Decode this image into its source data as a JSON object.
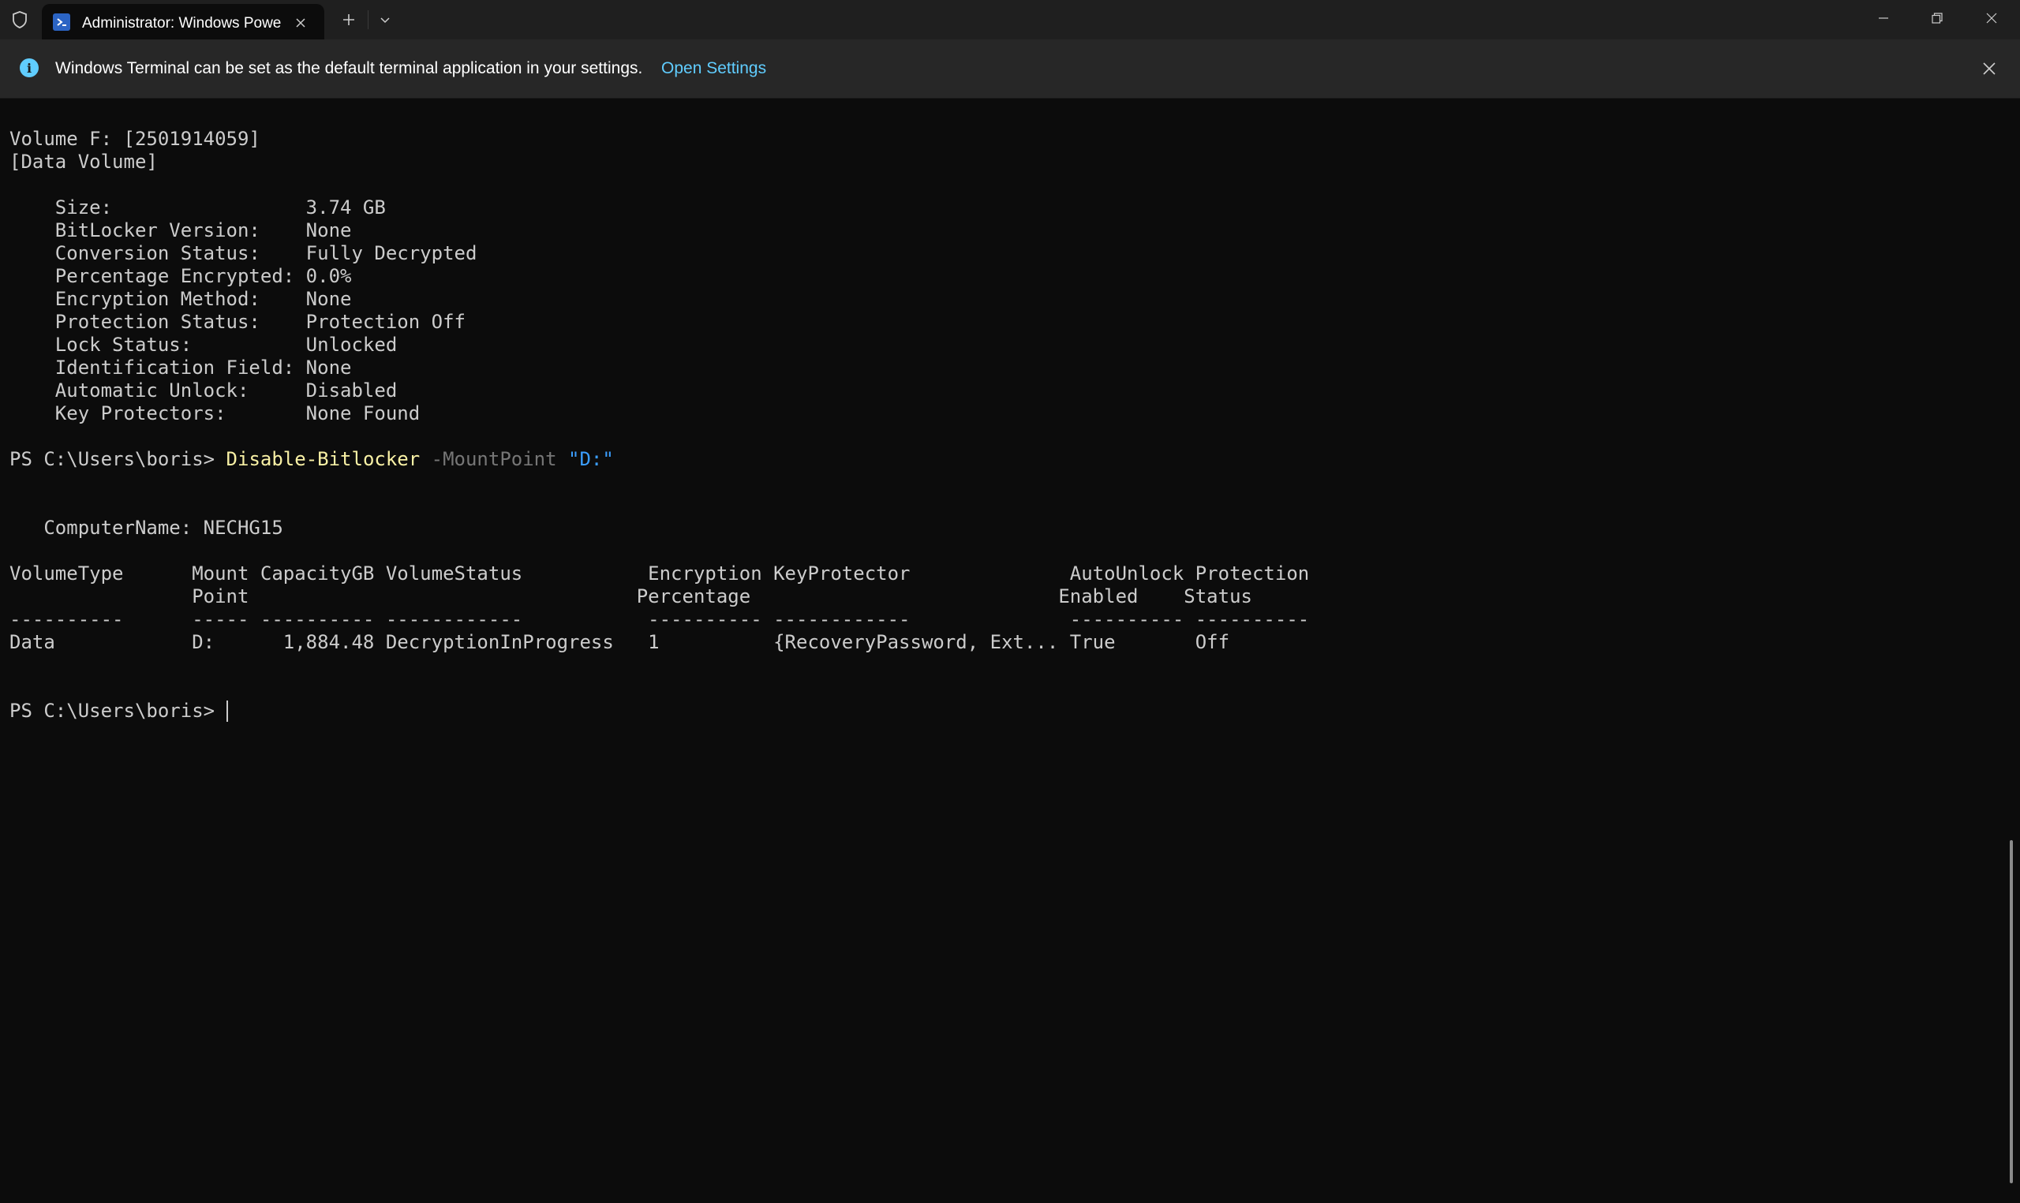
{
  "titlebar": {
    "tab_title": "Administrator: Windows PowerShell",
    "icons": {
      "shield": "shield-icon",
      "tab": "powershell-icon",
      "close": "close-icon",
      "new_tab": "plus-icon",
      "dropdown": "chevron-down-icon",
      "minimize": "minimize-icon",
      "restore": "restore-icon"
    }
  },
  "infobar": {
    "message": "Windows Terminal can be set as the default terminal application in your settings.",
    "link": "Open Settings",
    "icon": "info-icon"
  },
  "terminal": {
    "lines": [
      "Volume F: [2501914059]",
      "[Data Volume]",
      "",
      "    Size:                 3.74 GB",
      "    BitLocker Version:    None",
      "    Conversion Status:    Fully Decrypted",
      "    Percentage Encrypted: 0.0%",
      "    Encryption Method:    None",
      "    Protection Status:    Protection Off",
      "    Lock Status:          Unlocked",
      "    Identification Field: None",
      "    Automatic Unlock:     Disabled",
      "    Key Protectors:       None Found",
      ""
    ],
    "command_prompt": "PS C:\\Users\\boris> ",
    "command_name": "Disable-Bitlocker",
    "command_param": " -MountPoint ",
    "command_arg": "\"D:\"",
    "output_lines": [
      "",
      "",
      "   ComputerName: NECHG15",
      "",
      "VolumeType      Mount CapacityGB VolumeStatus           Encryption KeyProtector              AutoUnlock Protection",
      "                Point                                  Percentage                           Enabled    Status",
      "----------      ----- ---------- ------------           ---------- ------------              ---------- ----------",
      "Data            D:      1,884.48 DecryptionInProgress   1          {RecoveryPassword, Ext... True       Off",
      "",
      ""
    ],
    "final_prompt": "PS C:\\Users\\boris> "
  },
  "colors": {
    "background": "#0c0c0c",
    "titlebar": "#1f1f1f",
    "infobar": "#272727",
    "link": "#60cdff",
    "command": "#f9f1a5",
    "parameter": "#767676",
    "string": "#3b9eff"
  }
}
